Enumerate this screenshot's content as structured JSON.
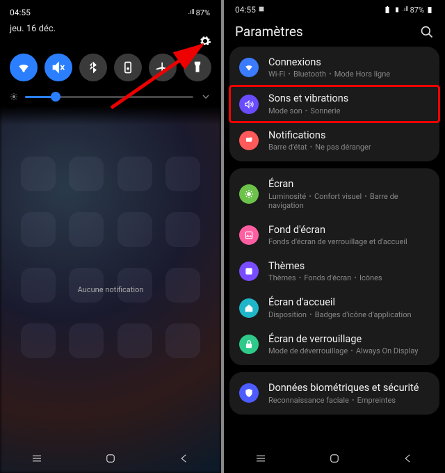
{
  "left": {
    "status": {
      "time": "04:55",
      "battery_pct": "87%"
    },
    "date": "jeu. 16 déc.",
    "quick_settings": [
      {
        "name": "wifi",
        "on": true
      },
      {
        "name": "mute-vibrate",
        "on": true
      },
      {
        "name": "bluetooth",
        "on": false
      },
      {
        "name": "portrait-lock",
        "on": false
      },
      {
        "name": "airplane",
        "on": false
      },
      {
        "name": "flashlight",
        "on": false
      }
    ],
    "brightness_pct": 18,
    "no_notification_text": "Aucune notification"
  },
  "right": {
    "status": {
      "time": "04:55",
      "battery_pct": "87%"
    },
    "title": "Paramètres",
    "groups": [
      {
        "items": [
          {
            "icon": "wifi",
            "color": "#3a7bff",
            "title": "Connexions",
            "subtitle": [
              "Wi-Fi",
              "Bluetooth",
              "Mode Hors ligne"
            ],
            "highlight": false
          },
          {
            "icon": "sound",
            "color": "#6a4cff",
            "title": "Sons et vibrations",
            "subtitle": [
              "Mode son",
              "Sonnerie"
            ],
            "highlight": true
          },
          {
            "icon": "notif",
            "color": "#ff5a5a",
            "title": "Notifications",
            "subtitle": [
              "Barre d'état",
              "Ne pas déranger"
            ],
            "highlight": false
          }
        ]
      },
      {
        "items": [
          {
            "icon": "display",
            "color": "#6cc24a",
            "title": "Écran",
            "subtitle": [
              "Luminosité",
              "Confort visuel",
              "Barre de navigation"
            ]
          },
          {
            "icon": "wall",
            "color": "#ff5fa2",
            "title": "Fond d'écran",
            "subtitle": [
              "Fonds d'écran de verrouillage et d'accueil"
            ]
          },
          {
            "icon": "theme",
            "color": "#7a4cff",
            "title": "Thèmes",
            "subtitle": [
              "Thèmes",
              "Fonds d'écran",
              "Icônes"
            ]
          },
          {
            "icon": "home",
            "color": "#1fb6c9",
            "title": "Écran d'accueil",
            "subtitle": [
              "Disposition",
              "Badges d'icône d'application"
            ]
          },
          {
            "icon": "lock",
            "color": "#2fc98a",
            "title": "Écran de verrouillage",
            "subtitle": [
              "Mode de déverrouillage",
              "Always On Display"
            ]
          }
        ]
      },
      {
        "items": [
          {
            "icon": "shield",
            "color": "#4c5cff",
            "title": "Données biométriques et sécurité",
            "subtitle": [
              "Reconnaissance faciale",
              "Empreintes"
            ]
          }
        ]
      }
    ]
  }
}
